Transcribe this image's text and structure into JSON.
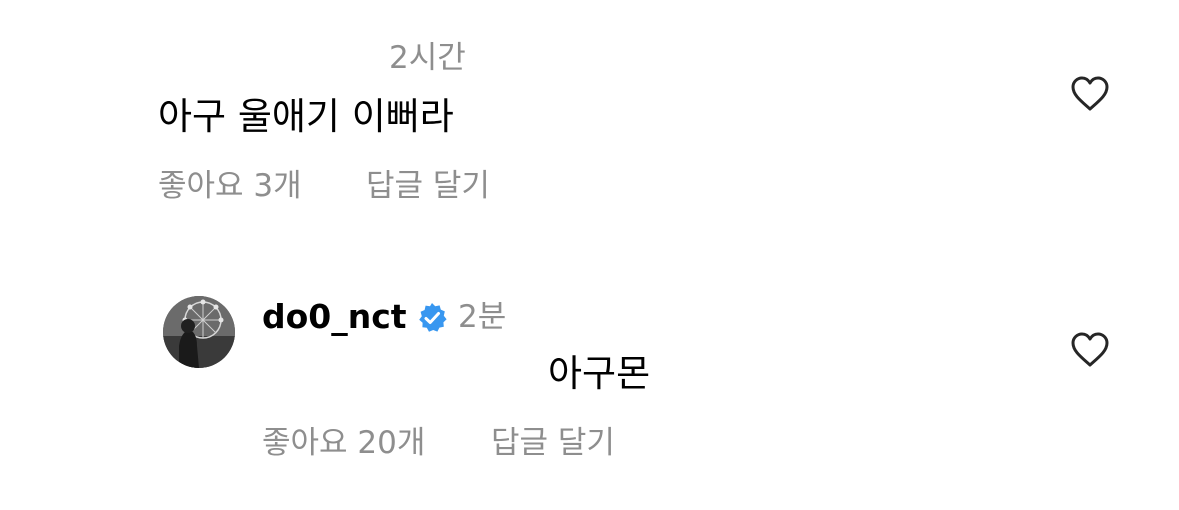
{
  "comments": [
    {
      "timestamp": "2시간",
      "text": "아구 울애기 이뻐라",
      "likes_label": "좋아요 3개",
      "reply_label": "답글 달기",
      "like_icon": "heart-outline-icon"
    },
    {
      "username": "do0_nct",
      "verified_icon": "verified-badge-icon",
      "timestamp": "2분",
      "text": "아구몬",
      "likes_label": "좋아요 20개",
      "reply_label": "답글 달기",
      "like_icon": "heart-outline-icon"
    }
  ],
  "colors": {
    "text_primary": "#000000",
    "text_secondary": "#8e8e8e",
    "verified_blue": "#3897f0",
    "background": "#ffffff"
  }
}
